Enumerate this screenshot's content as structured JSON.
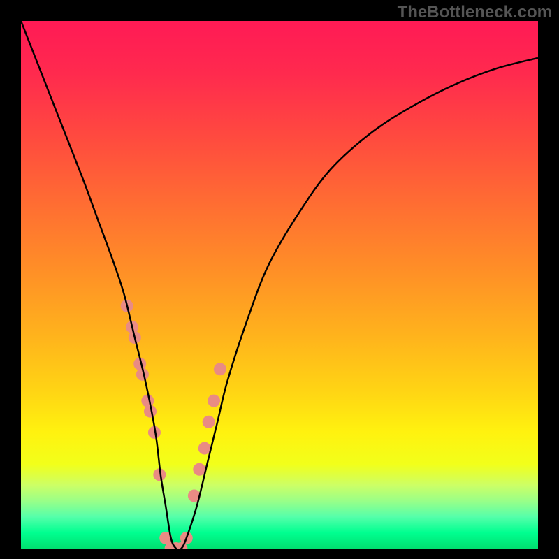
{
  "watermark": "TheBottleneck.com",
  "chart_data": {
    "type": "line",
    "title": "",
    "xlabel": "",
    "ylabel": "",
    "xlim": [
      0,
      100
    ],
    "ylim": [
      0,
      100
    ],
    "series": [
      {
        "name": "bottleneck-curve",
        "x": [
          0,
          4,
          8,
          12,
          15,
          18,
          20,
          22,
          24,
          26,
          27,
          28,
          29,
          30,
          31,
          32,
          34,
          36,
          38,
          40,
          44,
          48,
          54,
          60,
          68,
          76,
          84,
          92,
          100
        ],
        "y": [
          100,
          90,
          80,
          70,
          62,
          54,
          48,
          40,
          32,
          22,
          14,
          8,
          2,
          0,
          0,
          2,
          8,
          16,
          24,
          32,
          44,
          54,
          64,
          72,
          79,
          84,
          88,
          91,
          93
        ],
        "color": "#000000",
        "stroke_width": 2.5
      }
    ],
    "markers": {
      "name": "highlight-dots",
      "x": [
        20.5,
        21.5,
        22.0,
        23.0,
        23.5,
        24.5,
        25.0,
        25.8,
        26.8,
        28.0,
        29.0,
        30.0,
        31.0,
        32.0,
        33.5,
        34.5,
        35.5,
        36.3,
        37.3,
        38.5
      ],
      "y": [
        46,
        42,
        40,
        35,
        33,
        28,
        26,
        22,
        14,
        2,
        0,
        0,
        0,
        2,
        10,
        15,
        19,
        24,
        28,
        34
      ],
      "color": "#e98b84",
      "radius": 9
    },
    "gradient_stops": [
      {
        "offset": 0.0,
        "color": "#ff1a55"
      },
      {
        "offset": 0.1,
        "color": "#ff2a4e"
      },
      {
        "offset": 0.22,
        "color": "#ff4a3f"
      },
      {
        "offset": 0.35,
        "color": "#ff6e32"
      },
      {
        "offset": 0.48,
        "color": "#ff9126"
      },
      {
        "offset": 0.6,
        "color": "#ffb41c"
      },
      {
        "offset": 0.7,
        "color": "#ffd414"
      },
      {
        "offset": 0.78,
        "color": "#fff20f"
      },
      {
        "offset": 0.84,
        "color": "#f2ff1a"
      },
      {
        "offset": 0.88,
        "color": "#ccff66"
      },
      {
        "offset": 0.91,
        "color": "#99ff88"
      },
      {
        "offset": 0.94,
        "color": "#55ffaa"
      },
      {
        "offset": 0.97,
        "color": "#00ff90"
      },
      {
        "offset": 1.0,
        "color": "#00e070"
      }
    ]
  }
}
